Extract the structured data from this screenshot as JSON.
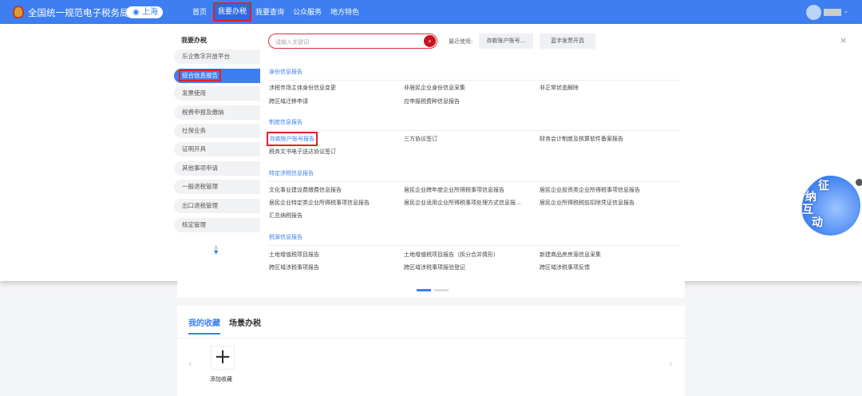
{
  "header": {
    "site_title": "全国统一规范电子税务局",
    "city": "上海",
    "nav": [
      "首页",
      "我要办税",
      "我要查询",
      "公众服务",
      "地方特色"
    ],
    "active_nav": "我要办税",
    "accent": "#3d7ff0"
  },
  "menu": {
    "title": "我要办税",
    "items": [
      "乐企数字开放平台",
      "综合信息报告",
      "发票使用",
      "税费申报及缴纳",
      "社保业务",
      "证明开具",
      "其他事项申请",
      "一般退税管理",
      "出口退税管理",
      "核定管理"
    ],
    "selected": "综合信息报告"
  },
  "search": {
    "placeholder": "请输入关键词",
    "recent_label": "最近使用:",
    "recent": [
      "存款账户账号...",
      "蓝字发票开具"
    ]
  },
  "sections": [
    {
      "title": "身份信息报告",
      "items": [
        "涉税市场主体身份信息变更",
        "非居民企业身份信息采集",
        "非正常状态解除",
        "跨区域迁移申请",
        "应申报税费种信息报告"
      ]
    },
    {
      "title": "制度信息报告",
      "items": [
        "存款账户账号报告",
        "三方协议签订",
        "财务会计制度及核算软件备案报告",
        "税务文书电子送达协议签订"
      ]
    },
    {
      "title": "特定涉税信息报告",
      "items": [
        "文化事业建设费缴费信息报告",
        "居民企业跨年度企业所得税事项信息报告",
        "居民企业投资类企业所得税事项信息报告",
        "居民企业特定类企业所得税事项信息报告",
        "居民企业适用企业所得税事项处理方式信息报...",
        "居民企业所得税税前扣除凭证信息报告",
        "汇总纳税报告"
      ]
    },
    {
      "title": "税源信息报告",
      "items": [
        "土地增值税项目报告",
        "土地增值税项目报告（拆分合并情形）",
        "新建商品房房源信息采集",
        "跨区域涉税事项报告",
        "跨区域涉税事项报验登记",
        "跨区域涉税事项反馈"
      ]
    }
  ],
  "highlighted_item": "存款账户账号报告",
  "mascot": {
    "text": [
      "征",
      "纳",
      "互",
      "动"
    ]
  },
  "favorites": {
    "tabs": [
      "我的收藏",
      "场景办税"
    ],
    "active_tab": "我的收藏",
    "add_label": "添加收藏"
  }
}
